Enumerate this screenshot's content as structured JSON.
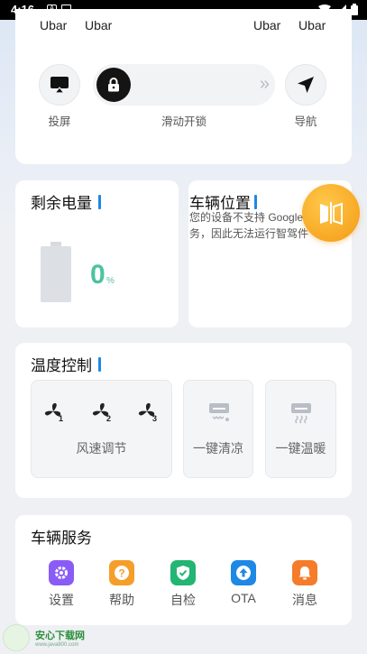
{
  "status_bar": {
    "time": "4:16"
  },
  "top": {
    "ubar_labels": [
      "Ubar",
      "Ubar",
      "Ubar",
      "Ubar"
    ],
    "buttons": [
      {
        "label": "投屏",
        "icon": "cast-screen-icon"
      },
      {
        "label": "滑动开锁",
        "icon": "lock-icon"
      },
      {
        "label": "导航",
        "icon": "navigation-arrow-icon"
      }
    ],
    "slider_arrows": "»"
  },
  "battery": {
    "title": "剩余电量",
    "value": "0",
    "unit": "%",
    "level": 0
  },
  "location": {
    "title": "车辆位置",
    "message": "您的设备不支持 Google Play 服务，因此无法运行智驾件"
  },
  "temperature": {
    "title": "温度控制",
    "fan_levels": [
      "1",
      "2",
      "3"
    ],
    "fan_label": "风速调节",
    "cool_label": "一键清凉",
    "warm_label": "一键温暖"
  },
  "services": {
    "title": "车辆服务",
    "items": [
      {
        "label": "设置",
        "color": "#8a5cf6",
        "icon": "gear-icon"
      },
      {
        "label": "帮助",
        "color": "#f59e2a",
        "icon": "question-icon"
      },
      {
        "label": "自检",
        "color": "#22b573",
        "icon": "shield-check-icon"
      },
      {
        "label": "OTA",
        "color": "#1e88e5",
        "icon": "upload-icon"
      },
      {
        "label": "消息",
        "color": "#f57c2a",
        "icon": "bell-icon"
      }
    ]
  },
  "watermark": {
    "name": "安心下载网",
    "url": "www.java800.com"
  },
  "colors": {
    "accent": "#1e88e5",
    "battery_text": "#4cc2a0",
    "float_button": "#f5a623"
  }
}
